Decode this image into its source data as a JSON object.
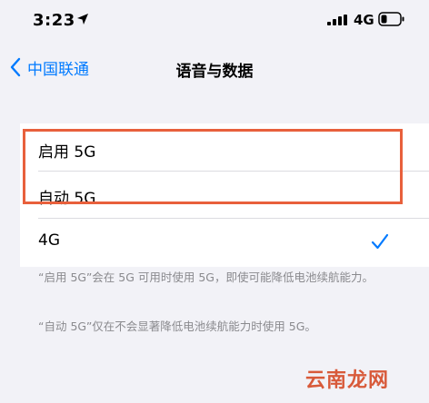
{
  "status_bar": {
    "time": "3:23",
    "network": "4G",
    "icons": [
      "location-arrow-icon",
      "cellular-signal-icon",
      "battery-icon"
    ]
  },
  "nav": {
    "back_label": "中国联通",
    "title": "语音与数据"
  },
  "options": [
    {
      "label": "启用 5G",
      "selected": false
    },
    {
      "label": "自动 5G",
      "selected": false
    },
    {
      "label": "4G",
      "selected": true
    }
  ],
  "footnotes": [
    "“启用 5G”会在 5G 可用时使用 5G，即使可能降低电池续航能力。",
    "“自动 5G”仅在不会显著降低电池续航能力时使用 5G。"
  ],
  "watermark": "云南龙网",
  "colors": {
    "accent": "#007aff",
    "highlight": "#e8603c",
    "background": "#f2f2f7",
    "secondary_text": "#8a8a8e"
  }
}
